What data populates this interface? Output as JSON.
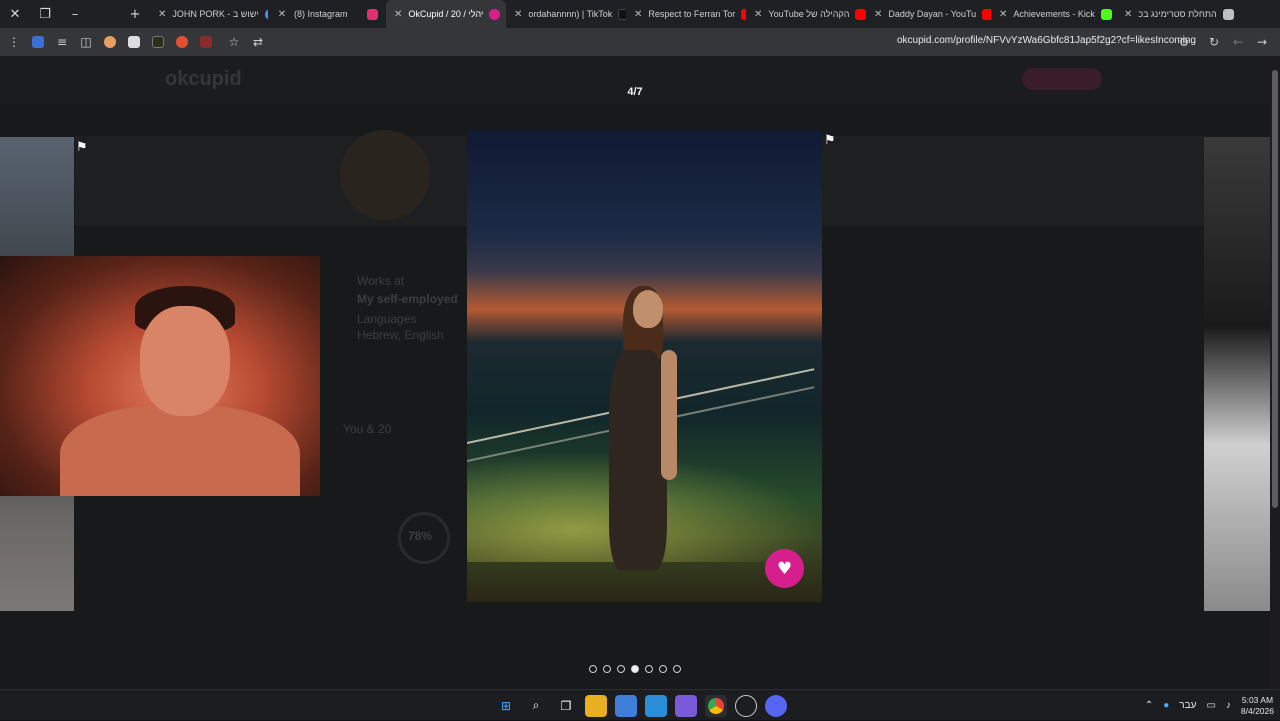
{
  "browser": {
    "tabs": [
      {
        "label": "JOHN PORK - ישוש ב",
        "favicon_color": "#4a8cf0",
        "active": false
      },
      {
        "label": "(8) Instagram",
        "favicon_color": "#e1306c",
        "active": false
      },
      {
        "label": "OkCupid / 20 / יהלי",
        "favicon_color": "#d61f8c",
        "active": true
      },
      {
        "label": "ordahannnn) | TikTok",
        "favicon_color": "#111111",
        "active": false
      },
      {
        "label": "Respect to Ferran Tor",
        "favicon_color": "#ff0000",
        "active": false
      },
      {
        "label": "YouTube הקהילה של",
        "favicon_color": "#ff0000",
        "active": false
      },
      {
        "label": "Daddy Dayan - YouTu",
        "favicon_color": "#ff0000",
        "active": false
      },
      {
        "label": "Achievements - Kick",
        "favicon_color": "#53fc18",
        "active": false
      },
      {
        "label": "התחלת סטרימינג בכ",
        "favicon_color": "#bfbfbf",
        "active": false
      }
    ],
    "url": "okcupid.com/profile/NFVvYzWa6Gbfc81Jap5f2g2?cf=likesIncoming"
  },
  "viewer": {
    "counter": "4/7",
    "photo_count": 7,
    "current_index": 4
  },
  "background_profile": {
    "logo": "okcupid",
    "line1": "Works at",
    "line2": "My self-employed",
    "line3": "Languages",
    "line4": "Hebrew, English",
    "line5": "You & 20",
    "match_percent": "78%"
  },
  "taskbar": {
    "language": "עבר",
    "time": "5:03 AM",
    "date": "8/4/2026"
  }
}
